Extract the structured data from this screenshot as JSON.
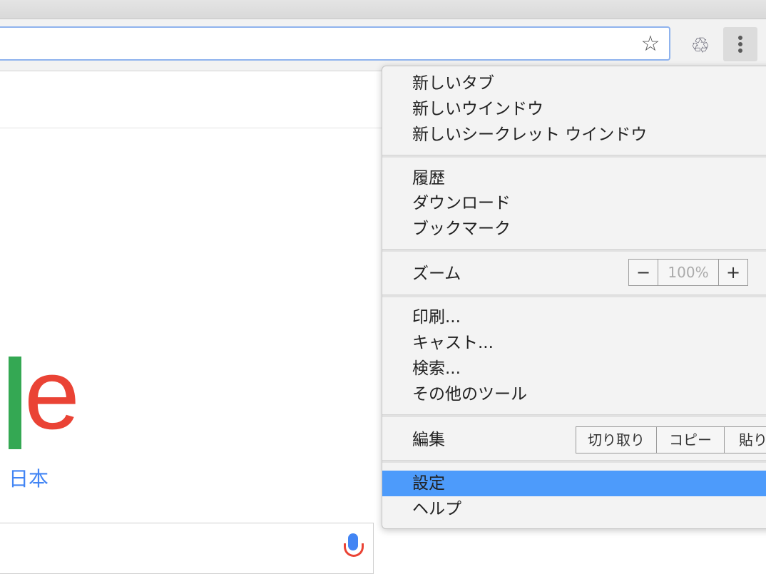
{
  "toolbar": {
    "star_glyph": "☆",
    "extension_icon": "recycle-icon",
    "menu_icon": "more-vert-icon"
  },
  "page": {
    "logo_partial": "e",
    "region_label": "日本"
  },
  "menu": {
    "group1": [
      "新しいタブ",
      "新しいウインドウ",
      "新しいシークレット ウインドウ"
    ],
    "group2": [
      "履歴",
      "ダウンロード",
      "ブックマーク"
    ],
    "zoom": {
      "label": "ズーム",
      "minus": "−",
      "value": "100%",
      "plus": "+"
    },
    "group4": [
      "印刷...",
      "キャスト...",
      "検索...",
      "その他のツール"
    ],
    "edit": {
      "label": "編集",
      "cut": "切り取り",
      "copy": "コピー",
      "paste": "貼り"
    },
    "settings": "設定",
    "help": "ヘルプ"
  },
  "colors": {
    "selected": "#4d9bfb",
    "google_green": "#34a853",
    "google_red": "#ea4335",
    "google_blue": "#4285f4"
  }
}
